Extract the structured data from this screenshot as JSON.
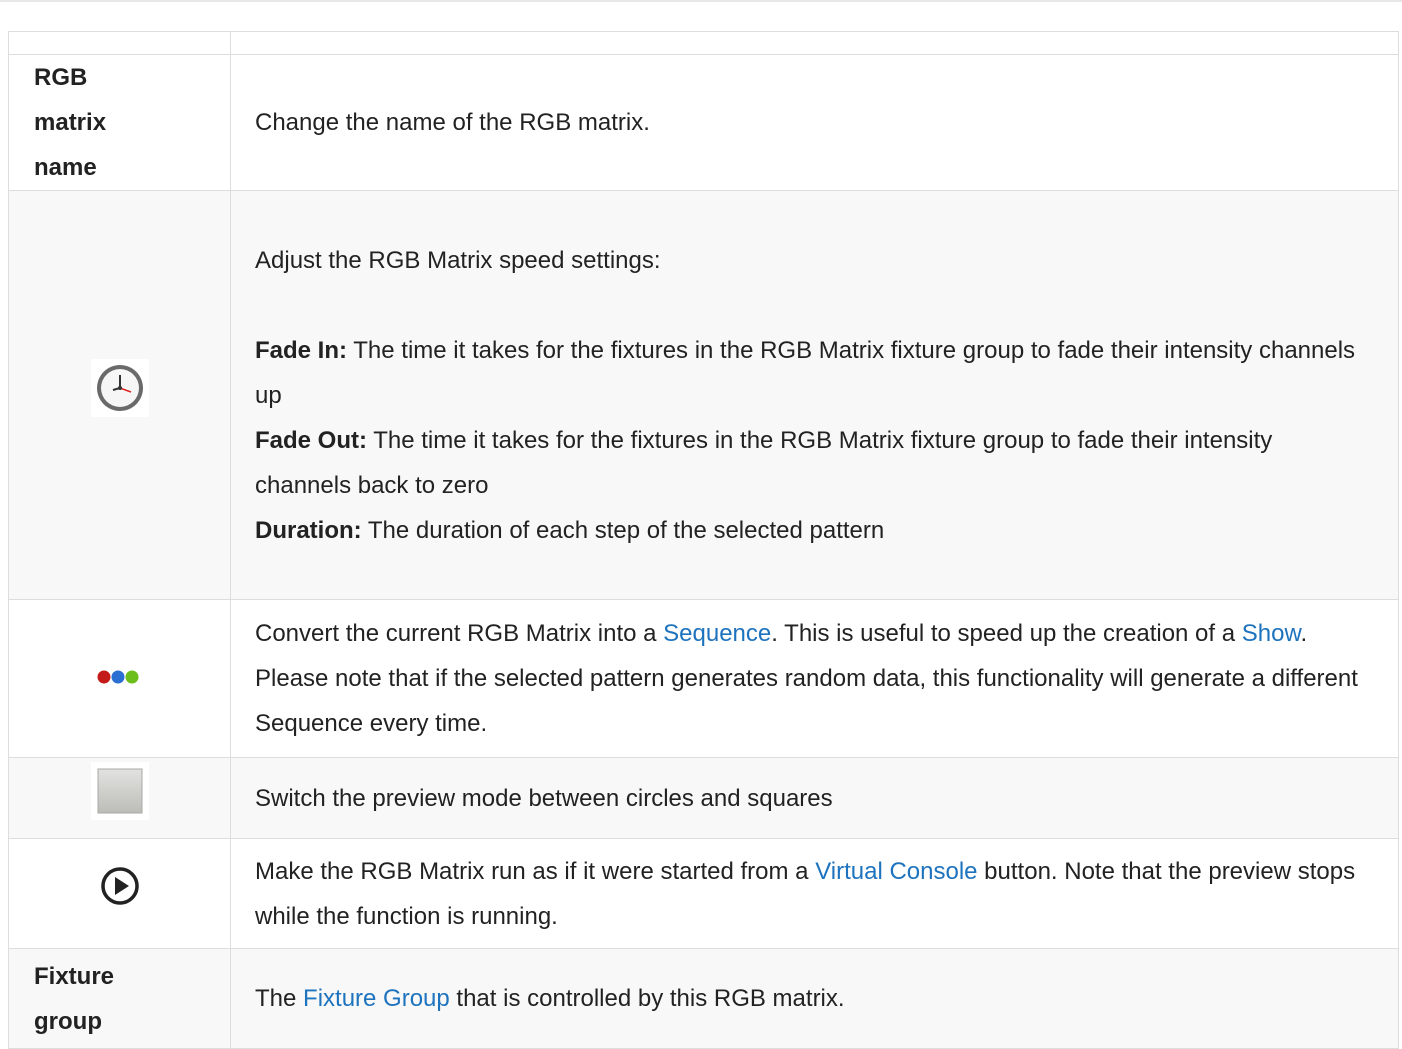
{
  "rows": [
    {
      "label": "RGB matrix name",
      "text": "Change the name of the RGB matrix."
    },
    {
      "icon": "clock-icon",
      "intro": "Adjust the RGB Matrix speed settings:",
      "fade_in_label": "Fade In:",
      "fade_in_text": " The time it takes for the fixtures in the RGB Matrix fixture group to fade their intensity channels up",
      "fade_out_label": "Fade Out:",
      "fade_out_text": " The time it takes for the fixtures in the RGB Matrix fixture group to fade their intensity channels back to zero",
      "duration_label": "Duration:",
      "duration_text": " The duration of each step of the selected pattern"
    },
    {
      "icon": "sequence-dots-icon",
      "t1": "Convert the current RGB Matrix into a ",
      "link1": "Sequence",
      "t2": ". This is useful to speed up the creation of a ",
      "link2": "Show",
      "t3": ". Please note that if the selected pattern generates random data, this functionality will generate a different Sequence every time."
    },
    {
      "icon": "square-preview-icon",
      "text": "Switch the preview mode between circles and squares"
    },
    {
      "icon": "play-icon",
      "t1": "Make the RGB Matrix run as if it were started from a ",
      "link1": "Virtual Console",
      "t2": " button. Note that the preview stops while the function is running."
    },
    {
      "label": "Fixture group",
      "t1": "The ",
      "link1": "Fixture Group",
      "t2": " that is controlled by this RGB matrix."
    }
  ],
  "colors": {
    "link": "#1e73be",
    "border": "#dddddd",
    "alt_row": "#f8f8f8"
  }
}
